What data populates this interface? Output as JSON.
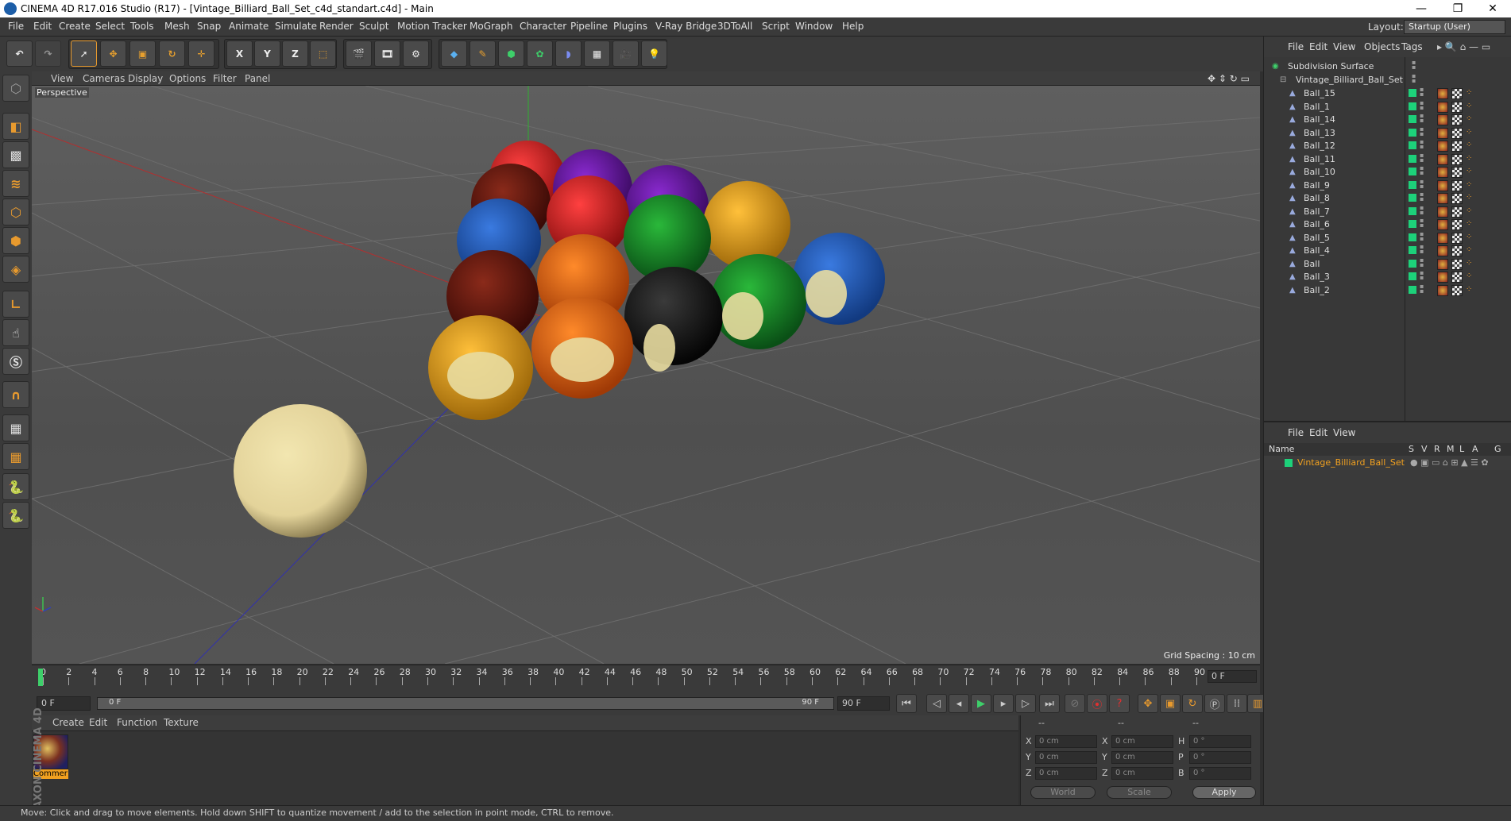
{
  "window": {
    "title": "CINEMA 4D R17.016 Studio (R17) - [Vintage_Billiard_Ball_Set_c4d_standart.c4d] - Main",
    "min_label": "—",
    "restore_label": "❐",
    "close_label": "✕"
  },
  "menubar": {
    "items": [
      "File",
      "Edit",
      "Create",
      "Select",
      "Tools",
      "Mesh",
      "Snap",
      "Animate",
      "Simulate",
      "Render",
      "Sculpt",
      "Motion Tracker",
      "MoGraph",
      "Character",
      "Pipeline",
      "Plugins",
      "V-Ray Bridge",
      "3DToAll",
      "Script",
      "Window",
      "Help"
    ],
    "layout_label": "Layout:",
    "layout_value": "Startup (User)"
  },
  "toolbar": {
    "axis_x": "X",
    "axis_y": "Y",
    "axis_z": "Z"
  },
  "view_menu": {
    "items": [
      "View",
      "Cameras",
      "Display",
      "Options",
      "Filter",
      "Panel"
    ],
    "camera_label": "Perspective",
    "grid_spacing": "Grid Spacing : 10 cm"
  },
  "timeline": {
    "ticks": [
      "0",
      "2",
      "4",
      "6",
      "8",
      "10",
      "12",
      "14",
      "16",
      "18",
      "20",
      "22",
      "24",
      "26",
      "28",
      "30",
      "32",
      "34",
      "36",
      "38",
      "40",
      "42",
      "44",
      "46",
      "48",
      "50",
      "52",
      "54",
      "56",
      "58",
      "60",
      "62",
      "64",
      "66",
      "68",
      "70",
      "72",
      "74",
      "76",
      "78",
      "80",
      "82",
      "84",
      "86",
      "88",
      "90"
    ],
    "current_frame": "0 F"
  },
  "transport": {
    "start_field": "0 F",
    "range_start": "0 F",
    "range_end": "90 F",
    "end_field": "90 F"
  },
  "material_menu": {
    "items": [
      "Create",
      "Edit",
      "Function",
      "Texture"
    ],
    "material_name": "Commer"
  },
  "coords": {
    "col_headers": [
      "--",
      "--",
      "--"
    ],
    "rows": [
      {
        "a": "X",
        "av": "0 cm",
        "b": "X",
        "bv": "0 cm",
        "c": "H",
        "cv": "0 °"
      },
      {
        "a": "Y",
        "av": "0 cm",
        "b": "Y",
        "bv": "0 cm",
        "c": "P",
        "cv": "0 °"
      },
      {
        "a": "Z",
        "av": "0 cm",
        "b": "Z",
        "bv": "0 cm",
        "c": "B",
        "cv": "0 °"
      }
    ],
    "world": "World",
    "scale": "Scale",
    "apply": "Apply"
  },
  "brand": "MAXON CINEMA 4D",
  "status": "Move: Click and drag to move elements. Hold down SHIFT to quantize movement / add to the selection in point mode, CTRL to remove.",
  "object_manager": {
    "menu": [
      "File",
      "Edit",
      "View",
      "Objects",
      "Tags"
    ],
    "root": "Subdivision Surface",
    "group": "Vintage_Billiard_Ball_Set",
    "balls": [
      "Ball_15",
      "Ball_1",
      "Ball_14",
      "Ball_13",
      "Ball_12",
      "Ball_11",
      "Ball_10",
      "Ball_9",
      "Ball_8",
      "Ball_7",
      "Ball_6",
      "Ball_5",
      "Ball_4",
      "Ball",
      "Ball_3",
      "Ball_2"
    ]
  },
  "attribute_manager": {
    "menu": [
      "File",
      "Edit",
      "View"
    ],
    "name_header": "Name",
    "col_headers": [
      "S",
      "V",
      "R",
      "M",
      "L",
      "A",
      "G"
    ],
    "row_name": "Vintage_Billiard_Ball_Set"
  }
}
